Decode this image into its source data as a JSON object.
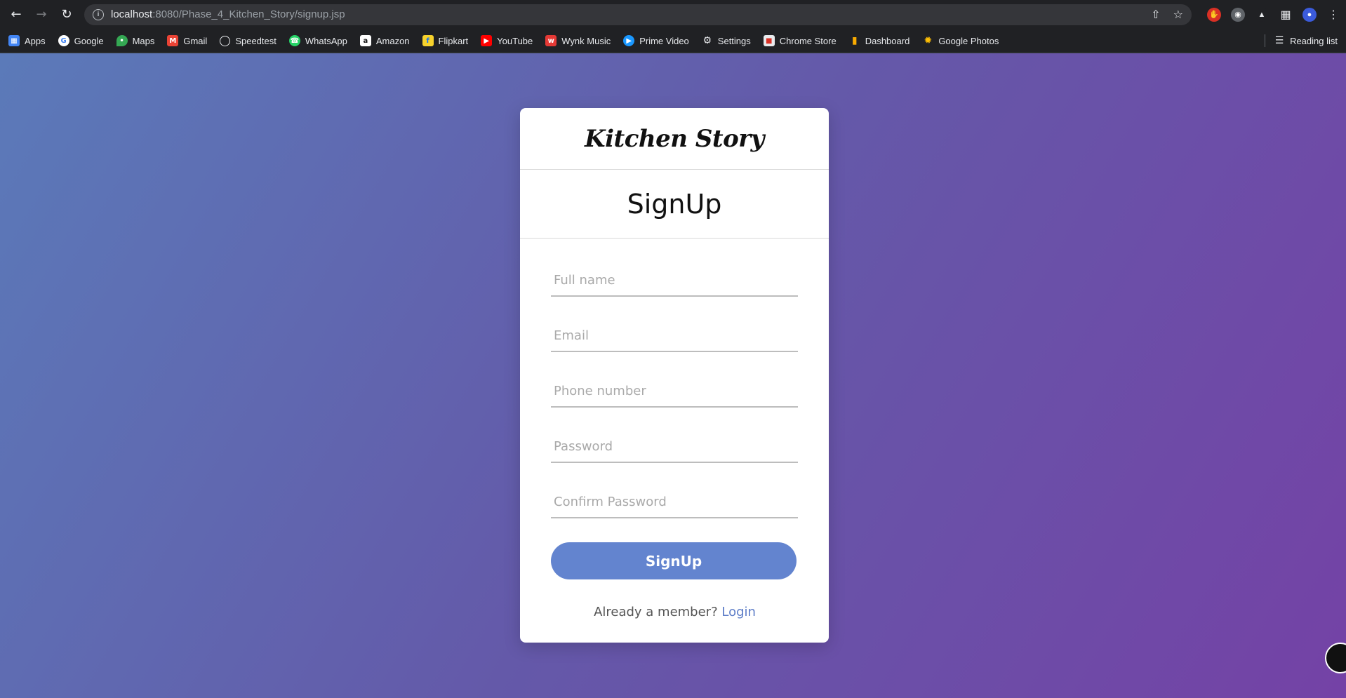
{
  "browser": {
    "url_host": "localhost",
    "url_rest": ":8080/Phase_4_Kitchen_Story/signup.jsp",
    "bookmarks": [
      {
        "label": "Apps",
        "icon": "apps-grid-icon",
        "color": "#4285f4"
      },
      {
        "label": "Google",
        "icon": "google-icon",
        "color": "#ffffff"
      },
      {
        "label": "Maps",
        "icon": "maps-icon",
        "color": "#34a853"
      },
      {
        "label": "Gmail",
        "icon": "gmail-icon",
        "color": "#ea4335"
      },
      {
        "label": "Speedtest",
        "icon": "speedtest-icon",
        "color": "#202124"
      },
      {
        "label": "WhatsApp",
        "icon": "whatsapp-icon",
        "color": "#25d366"
      },
      {
        "label": "Amazon",
        "icon": "amazon-icon",
        "color": "#ffffff"
      },
      {
        "label": "Flipkart",
        "icon": "flipkart-icon",
        "color": "#f7d22c"
      },
      {
        "label": "YouTube",
        "icon": "youtube-icon",
        "color": "#ff0000"
      },
      {
        "label": "Wynk Music",
        "icon": "wynk-music-icon",
        "color": "#e53935"
      },
      {
        "label": "Prime Video",
        "icon": "prime-video-icon",
        "color": "#1a98ff"
      },
      {
        "label": "Settings",
        "icon": "gear-icon",
        "color": "#202124"
      },
      {
        "label": "Chrome Store",
        "icon": "chrome-store-icon",
        "color": "#e8eaed"
      },
      {
        "label": "Dashboard",
        "icon": "dashboard-icon",
        "color": "#f9ab00"
      },
      {
        "label": "Google Photos",
        "icon": "google-photos-icon",
        "color": "#fbbc04"
      }
    ],
    "reading_list": "Reading list"
  },
  "card": {
    "brand": "Kitchen Story",
    "title": "SignUp",
    "fields": {
      "full_name": "Full name",
      "email": "Email",
      "phone": "Phone number",
      "password": "Password",
      "confirm_password": "Confirm Password"
    },
    "submit_label": "SignUp",
    "footer_text": "Already a member? ",
    "login_link": "Login"
  },
  "colors": {
    "accent": "#6384cf",
    "link": "#5c7cc7"
  }
}
